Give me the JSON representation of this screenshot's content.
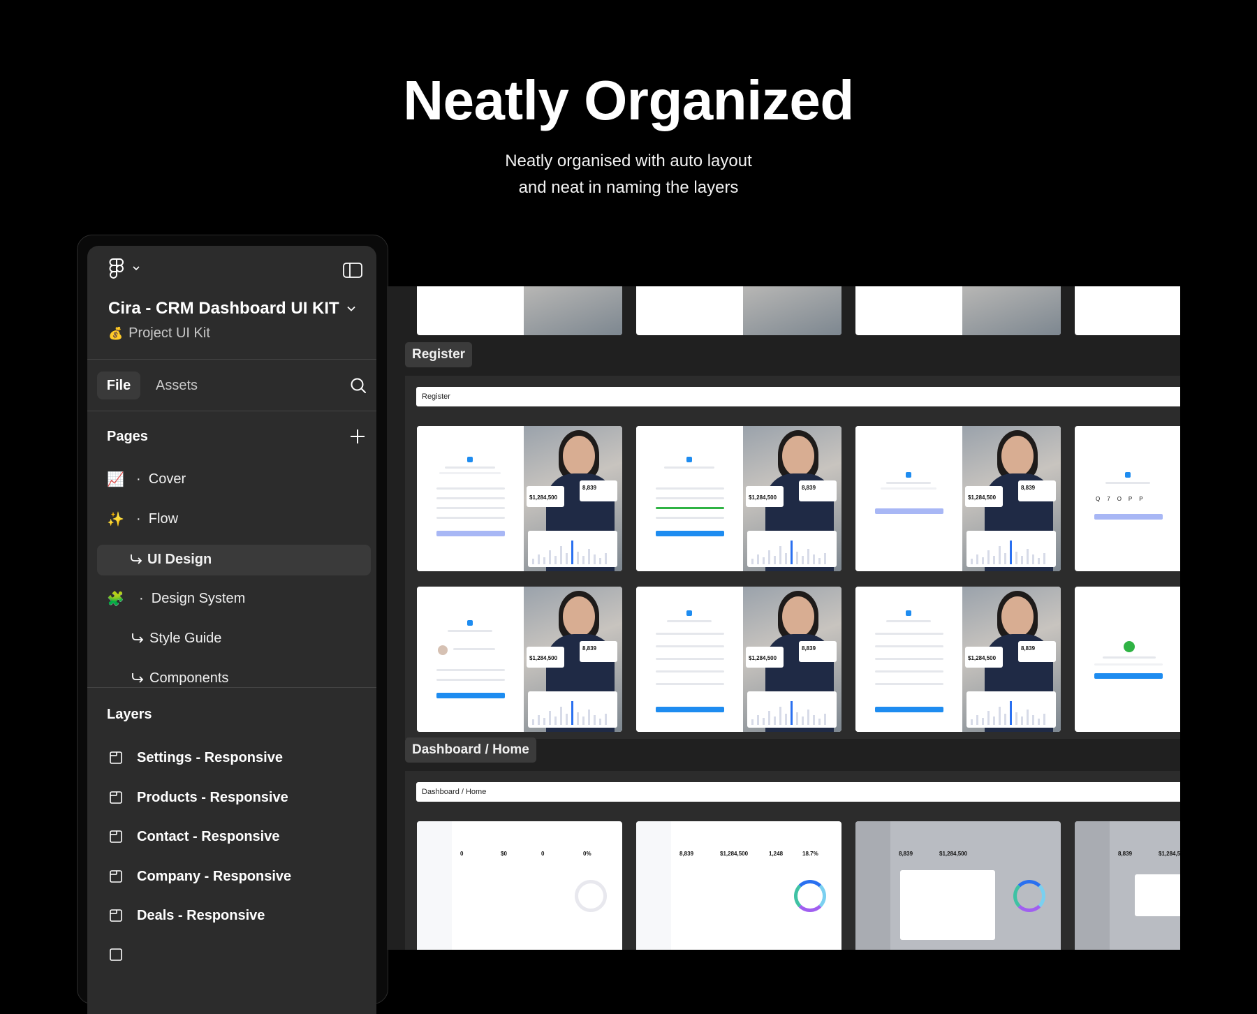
{
  "hero": {
    "title": "Neatly Organized",
    "subtitle_line1": "Neatly organised with auto layout",
    "subtitle_line2": "and neat in naming the layers"
  },
  "panel": {
    "project_title": "Cira - CRM Dashboard UI KIT",
    "project_emoji": "💰",
    "project_subtitle": "Project UI Kit",
    "tabs": {
      "file": "File",
      "assets": "Assets"
    },
    "pages_label": "Pages",
    "pages": [
      {
        "emoji": "📈",
        "label": "Cover"
      },
      {
        "emoji": "✨",
        "label": "Flow"
      },
      {
        "emoji": "",
        "label": "UI Design"
      },
      {
        "emoji": "🧩",
        "label": "Design System"
      },
      {
        "emoji": "",
        "label": "Style Guide"
      },
      {
        "emoji": "",
        "label": "Components"
      }
    ],
    "layers_label": "Layers",
    "layers": [
      {
        "label": "Settings - Responsive"
      },
      {
        "label": "Products - Responsive"
      },
      {
        "label": "Contact - Responsive"
      },
      {
        "label": "Company - Responsive"
      },
      {
        "label": "Deals - Responsive"
      }
    ]
  },
  "canvas": {
    "register_label": "Register",
    "register_bar": "Register",
    "dashboard_label": "Dashboard / Home",
    "dashboard_bar": "Dashboard / Home",
    "card_values": {
      "amount": "$1,284,500",
      "count": "8,839",
      "zero": "0",
      "money_zero": "$0",
      "percent_zero": "0%",
      "count2": "1,248",
      "percent": "18.7%"
    },
    "otp_letters": [
      "Q",
      "7",
      "O",
      "P",
      "P"
    ]
  },
  "colors": {
    "accent": "#1e8cf0",
    "panel_bg": "#2c2c2c",
    "canvas_bg": "#202020",
    "active_item": "#3a3a3a",
    "success": "#2fb344"
  }
}
